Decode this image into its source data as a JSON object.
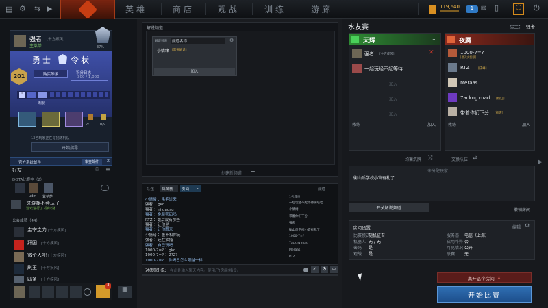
{
  "nav": {
    "tabs": [
      "英雄",
      "商店",
      "观战",
      "训练",
      "游廊"
    ],
    "coins": "119,640",
    "notifications": "1"
  },
  "profile": {
    "name": "强者",
    "tag": "[十方疾风]",
    "status": "主菜单",
    "rank_pct": "37%",
    "title": "勇士",
    "title2": "令状",
    "level": "201",
    "buy_level": "购买等级",
    "points_label": "积分日志",
    "points": "300 / 1,000",
    "slot_unlocked": "1",
    "unlock_text": "无限",
    "stat1": "2/11",
    "stat2": "0/9",
    "events_text": "13名玩家正在寻找随机队",
    "guide_btn": "开始指导",
    "announce": "官方系统邮件",
    "review_btn": "审查邮件"
  },
  "friends": {
    "title": "好友",
    "group1": "DOTA比赛中（2）",
    "group2": "公会成员（44）",
    "mini1": "udm",
    "mini2": "紫花萨",
    "list": [
      {
        "name": "这游戏不会玩了",
        "status": "游戏进行了2弹公路"
      },
      {
        "name": "圭宰之力",
        "tag": "[十方疾风]",
        "status": "..."
      },
      {
        "name": "拜困",
        "tag": "[十方疾风]",
        "status": "离线"
      },
      {
        "name": "微个人吧",
        "tag": "[十方疾风]",
        "status": "..."
      },
      {
        "name": "刷王",
        "tag": "[十方疾风]",
        "status": "..."
      },
      {
        "name": "四条",
        "tag": "[十方疾风]",
        "status": "..."
      }
    ],
    "badge": "3"
  },
  "casters": {
    "title": "解说频道",
    "header": "解说频道",
    "channel_label": "频道名称",
    "user": "小情绪",
    "user_note": "[需要解说]",
    "add": "加入",
    "create": "创建新频道"
  },
  "chat": {
    "tabs": [
      "队伍",
      "群英荟",
      "房间"
    ],
    "tab_right": "频道",
    "input_label": "对(房间)说:",
    "input_placeholder": "在此处输入聊天内容。使用尸[房间]指令。",
    "lines": [
      "小情绪 ：毛毛过来",
      "强者 ：gkd",
      "强者 ：ni gaosu",
      "强者 ：免费密码吗",
      "RTZ ：最后没有那些",
      "强者 ：让他坐",
      "强者 ：让他跟来",
      "小情绪 ：鱼不和你玩",
      "强者 ：还在抽搐",
      "强者 ：自己玩吧",
      "1000-7=? ：gkd",
      "1000-7=? ：2?2?",
      "1000-7=? ：你喝巴怎么跟越一样"
    ],
    "members_head": "1名成员",
    "members": [
      "一起玩经不起等待咳咳吐",
      "小情绪",
      "带着你们下分",
      "强者",
      "衡山后学校小官有礼了",
      "1000-7=?",
      "7ackng mad",
      "Meraas",
      "RTZ"
    ]
  },
  "lobby": {
    "title": "水友赛",
    "host_label": "房主：",
    "host": "强者",
    "radiant": "天辉",
    "dire": "夜魇",
    "radiant_players": [
      {
        "name": "强者",
        "tag": "[十方疾风]"
      },
      {
        "name": "一起玩经不起等待..."
      }
    ],
    "dire_players": [
      {
        "name": "1000-7=?",
        "tag": "[暴天灾狂喷]"
      },
      {
        "name": "RTZ",
        "tag": "[成峰]"
      },
      {
        "name": "Meraas"
      },
      {
        "name": "7ackng mad",
        "tag": "[粉红]"
      },
      {
        "name": "带着你们下分",
        "tag": "[极客]"
      }
    ],
    "join": "加入",
    "coach": "教练",
    "balance": "均衡洗牌",
    "swap": "交换队伍",
    "unassigned": "未分配玩家",
    "unassigned_player": "衡山后学校小官有礼了",
    "join_casters": "开关解说频道",
    "abandon": "撤销房间",
    "settings_title": "房间设置",
    "edit": "编辑",
    "settings": [
      [
        "比赛模式",
        "随机征召"
      ],
      [
        "机器人",
        "无 / 无"
      ],
      [
        "密码",
        "是"
      ],
      [
        "观战",
        "是"
      ]
    ],
    "settings2": [
      [
        "服务器",
        "电信（上海）"
      ],
      [
        "启用作弊",
        "否"
      ],
      [
        "可见情况",
        "公开"
      ],
      [
        "联赛",
        "无"
      ]
    ],
    "leave": "离开这个房间",
    "start": "开始比赛"
  }
}
